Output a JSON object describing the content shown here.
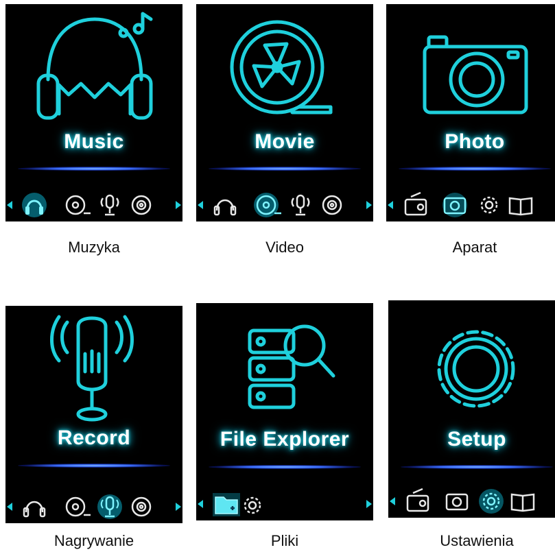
{
  "screens": [
    {
      "title": "Music",
      "caption": "Muzyka",
      "main_icon": "headphones-icon",
      "bar_icons": [
        "headphones-icon",
        "film-reel-icon",
        "microphone-icon",
        "disc-icon"
      ],
      "selected": "headphones-icon"
    },
    {
      "title": "Movie",
      "caption": "Video",
      "main_icon": "film-reel-icon",
      "bar_icons": [
        "headphones-icon",
        "film-reel-icon",
        "microphone-icon",
        "disc-icon"
      ],
      "selected": "film-reel-icon"
    },
    {
      "title": "Photo",
      "caption": "Aparat",
      "main_icon": "camera-icon",
      "bar_icons": [
        "radio-icon",
        "camera-icon",
        "gear-icon",
        "book-icon"
      ],
      "selected": "camera-icon"
    },
    {
      "title": "Record",
      "caption": "Nagrywanie",
      "main_icon": "microphone-icon",
      "bar_icons": [
        "headphones-icon",
        "film-reel-icon",
        "microphone-icon",
        "disc-icon"
      ],
      "selected": "microphone-icon"
    },
    {
      "title": "File Explorer",
      "caption": "Pliki",
      "main_icon": "file-explorer-icon",
      "bar_icons": [
        "folder-add-icon",
        "gear-icon"
      ],
      "selected": "folder-add-icon"
    },
    {
      "title": "Setup",
      "caption": "Ustawienia",
      "main_icon": "gear-icon",
      "bar_icons": [
        "radio-icon",
        "camera-icon",
        "gear-icon",
        "book-icon"
      ],
      "selected": "gear-icon"
    }
  ],
  "colors": {
    "neon": "#1fd0dc",
    "bar_glow": "#3a6dff",
    "screen_bg": "#000000"
  }
}
